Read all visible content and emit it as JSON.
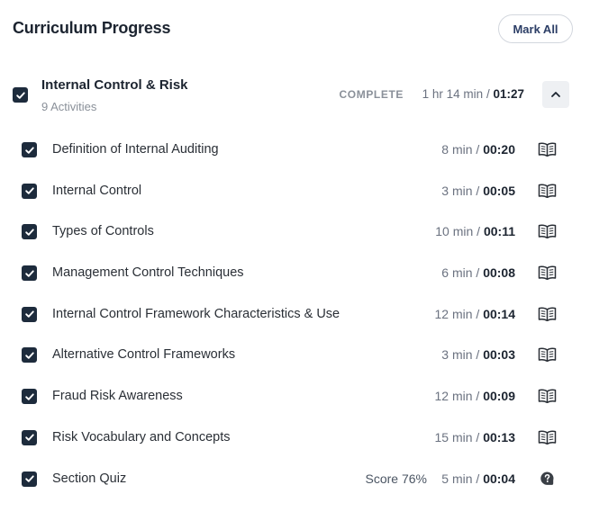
{
  "header": {
    "title": "Curriculum Progress",
    "mark_all_label": "Mark All"
  },
  "section": {
    "title": "Internal Control & Risk",
    "subtitle": "9 Activities",
    "status": "COMPLETE",
    "estimated": "1 hr 14 min",
    "separator": " / ",
    "elapsed": "01:27",
    "checked": true
  },
  "activities": [
    {
      "title": "Definition of Internal Auditing",
      "estimated": "8 min",
      "elapsed": "00:20",
      "score": "",
      "icon": "book-icon"
    },
    {
      "title": "Internal Control",
      "estimated": "3 min",
      "elapsed": "00:05",
      "score": "",
      "icon": "book-icon"
    },
    {
      "title": "Types of Controls",
      "estimated": "10 min",
      "elapsed": "00:11",
      "score": "",
      "icon": "book-icon"
    },
    {
      "title": "Management Control Techniques",
      "estimated": "6 min",
      "elapsed": "00:08",
      "score": "",
      "icon": "book-icon"
    },
    {
      "title": "Internal Control Framework Characteristics & Use",
      "estimated": "12 min",
      "elapsed": "00:14",
      "score": "",
      "icon": "book-icon"
    },
    {
      "title": "Alternative Control Frameworks",
      "estimated": "3 min",
      "elapsed": "00:03",
      "score": "",
      "icon": "book-icon"
    },
    {
      "title": "Fraud Risk Awareness",
      "estimated": "12 min",
      "elapsed": "00:09",
      "score": "",
      "icon": "book-icon"
    },
    {
      "title": "Risk Vocabulary and Concepts",
      "estimated": "15 min",
      "elapsed": "00:13",
      "score": "",
      "icon": "book-icon"
    },
    {
      "title": "Section Quiz",
      "estimated": "5 min",
      "elapsed": "00:04",
      "score": "Score 76%",
      "icon": "quiz-help-icon"
    }
  ],
  "colors": {
    "checkbox": "#1d2b3c",
    "accent_text": "#2c3e66",
    "muted": "#8a9099"
  }
}
